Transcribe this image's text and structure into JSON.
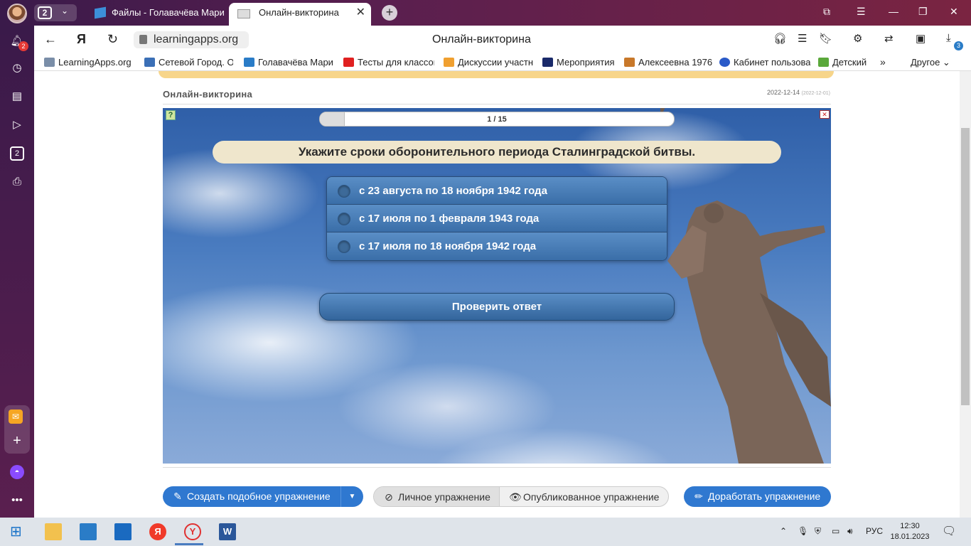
{
  "browser": {
    "tab_count": "2",
    "tabs": [
      {
        "label": "Файлы - Голавачёва Мари"
      },
      {
        "label": "Онлайн-викторина"
      }
    ],
    "url": "learningapps.org",
    "page_title": "Онлайн-викторина",
    "notification_count": "2",
    "downloads_count": "3",
    "side_counter": "2"
  },
  "bookmarks": [
    {
      "label": "LearningApps.org",
      "color": "#7a8ea8"
    },
    {
      "label": "Сетевой Город. О",
      "color": "#3b6fb6"
    },
    {
      "label": "Голавачёва Мари",
      "color": "#2a7cc7"
    },
    {
      "label": "Тесты для классов",
      "color": "#e02020"
    },
    {
      "label": "Дискуссии участн",
      "color": "#f0a030"
    },
    {
      "label": "Мероприятия",
      "color": "#1a2a6a"
    },
    {
      "label": "Алексеевна 1976",
      "color": "#c8782a"
    },
    {
      "label": "Кабинет пользова",
      "color": "#2a5ac8"
    },
    {
      "label": "Детский",
      "color": "#5aa83a"
    }
  ],
  "bookmarks_more": "Другое",
  "app": {
    "title": "Онлайн-викторина",
    "date": "2022-12-14",
    "date_sub": "(2022-12-01)"
  },
  "quiz": {
    "progress_text": "1 / 15",
    "progress": 0.07,
    "question": "Укажите сроки оборонительного периода Сталинградской битвы.",
    "answers": [
      "с 23 августа по 18 ноября 1942 года",
      "с 17 июля по 1 февраля 1943 года",
      "с 17 июля по 18 ноября 1942 года"
    ],
    "check_label": "Проверить ответ"
  },
  "actions": {
    "create_similar": "Создать подобное упражнение",
    "private": "Личное упражнение",
    "published": "Опубликованное упражнение",
    "improve": "Доработать упражнение"
  },
  "taskbar": {
    "lang": "РУС",
    "time": "12:30",
    "date": "18.01.2023"
  },
  "colors": {
    "accent": "#2f78d0",
    "answer_blue": "#3a6ea8",
    "question_bg": "#efe6cc"
  }
}
